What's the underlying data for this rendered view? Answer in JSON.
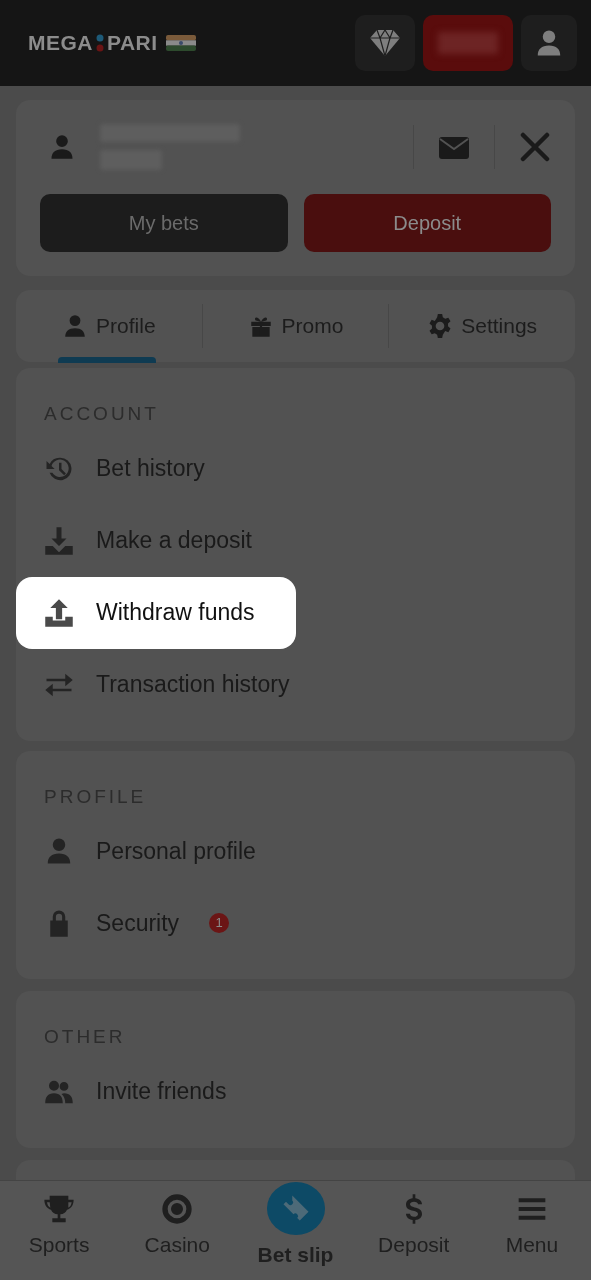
{
  "header": {
    "logo": {
      "left": "MEGA",
      "right": "PARI"
    }
  },
  "user_panel": {
    "buttons": [
      {
        "label": "My bets",
        "kind": "dark"
      },
      {
        "label": "Deposit",
        "kind": "primary"
      }
    ]
  },
  "tabs": [
    {
      "label": "Profile",
      "kind": "person",
      "selected": true
    },
    {
      "label": "Promo",
      "kind": "gift",
      "selected": false
    },
    {
      "label": "Settings",
      "kind": "gear",
      "selected": false
    }
  ],
  "sections": [
    {
      "title": "ACCOUNT",
      "items": [
        {
          "label": "Bet history",
          "kind": "history",
          "highlighted": false
        },
        {
          "label": "Make a deposit",
          "kind": "download",
          "highlighted": false
        },
        {
          "label": "Withdraw funds",
          "kind": "upload",
          "highlighted": true
        },
        {
          "label": "Transaction history",
          "kind": "transfer",
          "highlighted": false
        }
      ]
    },
    {
      "title": "PROFILE",
      "items": [
        {
          "label": "Personal profile",
          "kind": "person",
          "highlighted": false
        },
        {
          "label": "Security",
          "kind": "lock",
          "highlighted": false,
          "badge": "1"
        }
      ]
    },
    {
      "title": "OTHER",
      "items": [
        {
          "label": "Invite friends",
          "kind": "people",
          "highlighted": false
        }
      ]
    }
  ],
  "bottom_nav": [
    {
      "label": "Sports",
      "kind": "trophy",
      "selected": false
    },
    {
      "label": "Casino",
      "kind": "chip",
      "selected": false
    },
    {
      "label": "Bet slip",
      "kind": "ticket",
      "selected": true
    },
    {
      "label": "Deposit",
      "kind": "dollar",
      "selected": false
    },
    {
      "label": "Menu",
      "kind": "menu",
      "selected": false
    }
  ]
}
